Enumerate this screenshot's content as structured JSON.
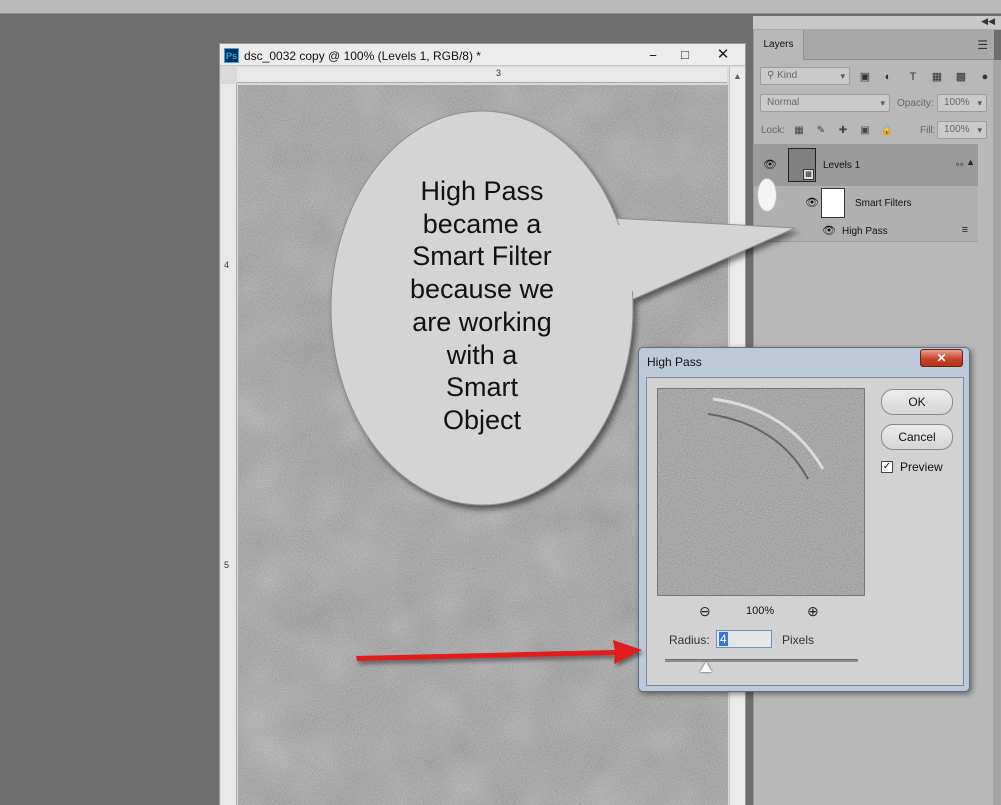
{
  "document": {
    "title": "dsc_0032 copy @ 100% (Levels 1, RGB/8) *",
    "app_icon_label": "Ps",
    "window_controls": [
      "minimize-icon",
      "maximize-icon",
      "close-icon"
    ],
    "ruler": {
      "top_labels": [
        "3"
      ],
      "left_labels": [
        "4",
        "5"
      ]
    }
  },
  "layers_panel": {
    "tab_label": "Layers",
    "filter_placeholder": "Kind",
    "blend_mode": "Normal",
    "opacity_label": "Opacity:",
    "opacity_value": "100%",
    "lock_label": "Lock:",
    "fill_label": "Fill:",
    "fill_value": "100%",
    "layers": [
      {
        "name": "Levels 1",
        "visible": true,
        "selected": true,
        "type": "smart-object"
      },
      {
        "name": "Smart Filters",
        "visible": true,
        "type": "smart-filters"
      },
      {
        "name": "High Pass",
        "visible": true,
        "type": "filter"
      }
    ]
  },
  "callout": {
    "text": "High Pass\nbecame a\nSmart Filter\nbecause we\nare working\nwith a\nSmart\nObject"
  },
  "high_pass_dialog": {
    "title": "High Pass",
    "ok_label": "OK",
    "cancel_label": "Cancel",
    "preview_label": "Preview",
    "preview_checked": true,
    "zoom_level": "100%",
    "radius_label": "Radius:",
    "radius_value": "4",
    "units_label": "Pixels",
    "slider_fraction": 0.21
  },
  "colors": {
    "arrow": "#e11b1b",
    "dialog_frame": "#bcc9d8",
    "close_button": "#c8452d",
    "selection": "#3875d7"
  }
}
